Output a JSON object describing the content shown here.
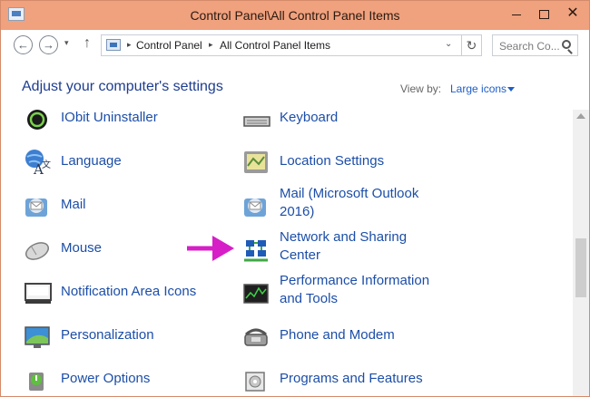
{
  "window": {
    "title": "Control Panel\\All Control Panel Items",
    "close_glyph": "✕"
  },
  "navigation": {
    "back_glyph": "←",
    "forward_glyph": "→",
    "recent_glyph": "▾",
    "up_glyph": "↑",
    "breadcrumbs": [
      "Control Panel",
      "All Control Panel Items"
    ],
    "crumb_separator": "▸",
    "dropdown_glyph": "⌄",
    "refresh_glyph": "↻",
    "search_placeholder": "Search Co..."
  },
  "header": {
    "title": "Adjust your computer's settings",
    "view_by_label": "View by:",
    "view_by_value": "Large icons"
  },
  "left_column": [
    {
      "label": "IObit Uninstaller",
      "icon": "iobit-icon"
    },
    {
      "label": "Language",
      "icon": "language-icon"
    },
    {
      "label": "Mail",
      "icon": "mail-icon"
    },
    {
      "label": "Mouse",
      "icon": "mouse-icon"
    },
    {
      "label": "Notification Area Icons",
      "icon": "notification-area-icon"
    },
    {
      "label": "Personalization",
      "icon": "personalization-icon"
    },
    {
      "label": "Power Options",
      "icon": "power-options-icon"
    }
  ],
  "right_column": [
    {
      "label": "Keyboard",
      "icon": "keyboard-icon"
    },
    {
      "label": "Location Settings",
      "icon": "location-icon"
    },
    {
      "label": "Mail (Microsoft Outlook",
      "label2": "2016)",
      "icon": "mail-outlook-icon"
    },
    {
      "label": "Network and Sharing",
      "label2": "Center",
      "icon": "network-icon"
    },
    {
      "label": "Performance Information",
      "label2": "and Tools",
      "icon": "performance-icon"
    },
    {
      "label": "Phone and Modem",
      "icon": "phone-modem-icon"
    },
    {
      "label": "Programs and Features",
      "icon": "programs-icon"
    }
  ],
  "colors": {
    "titlebar": "#f0a17e",
    "link": "#1c4ea8",
    "heading": "#1e3d8f",
    "annotation_arrow": "#d61fc7"
  }
}
